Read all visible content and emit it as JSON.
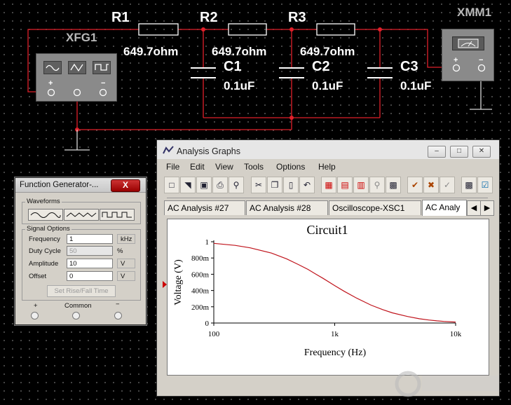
{
  "schematic": {
    "resistors": [
      {
        "name": "R1",
        "value": "649.7ohm"
      },
      {
        "name": "R2",
        "value": "649.7ohm"
      },
      {
        "name": "R3",
        "value": "649.7ohm"
      }
    ],
    "capacitors": [
      {
        "name": "C1",
        "value": "0.1uF"
      },
      {
        "name": "C2",
        "value": "0.1uF"
      },
      {
        "name": "C3",
        "value": "0.1uF"
      }
    ],
    "generator": {
      "name": "XFG1",
      "plus": "+",
      "minus": "−"
    },
    "multimeter": {
      "name": "XMM1",
      "plus": "+",
      "minus": "−"
    },
    "colors": {
      "wire": "#e0202a",
      "ground": "#d8d8d8",
      "component": "#ffffff"
    }
  },
  "function_generator": {
    "title": "Function Generator-...",
    "close_label": "X",
    "waveforms_label": "Waveforms",
    "signal_options_label": "Signal Options",
    "fields": [
      {
        "label": "Frequency",
        "value": "1",
        "unit": "kHz",
        "disabled": false
      },
      {
        "label": "Duty Cycle",
        "value": "50",
        "unit": "%",
        "disabled": true
      },
      {
        "label": "Amplitude",
        "value": "10",
        "unit": "V",
        "disabled": false
      },
      {
        "label": "Offset",
        "value": "0",
        "unit": "V",
        "disabled": false
      }
    ],
    "set_rise_fall_label": "Set Rise/Fall Time",
    "terminals": {
      "plus": "+",
      "common": "Common",
      "minus": "−"
    },
    "waveform_icons": [
      "sine-wave-icon",
      "triangle-wave-icon",
      "square-wave-icon"
    ]
  },
  "analysis_graphs": {
    "title": "Analysis Graphs",
    "window_buttons": {
      "minimize": "–",
      "maximize": "□",
      "close": "✕"
    },
    "menu": [
      "File",
      "Edit",
      "View",
      "Tools",
      "Options",
      "Help"
    ],
    "toolbar_icons": [
      "new-file-icon",
      "open-folder-icon",
      "save-icon",
      "print-icon",
      "print-preview-icon",
      "cut-icon",
      "copy-icon",
      "paste-icon",
      "undo-icon",
      "grid-icon",
      "legend-icon",
      "cursors-icon",
      "zoom-icon",
      "reverse-colors-icon",
      "properties-icon",
      "restore-icon",
      "export-icon",
      "overlay-traces-icon",
      "export-excel-icon"
    ],
    "tabs": [
      "AC Analysis #27",
      "AC Analysis #28",
      "Oscilloscope-XSC1",
      "AC Analy"
    ],
    "active_tab": 3,
    "tab_scroll": {
      "left": "◀",
      "right": "▶"
    }
  },
  "chart_data": {
    "type": "line",
    "title": "Circuit1",
    "xlabel": "Frequency (Hz)",
    "ylabel": "Voltage (V)",
    "x_scale": "log",
    "xlim": [
      100,
      10000
    ],
    "ylim": [
      0,
      1
    ],
    "x_ticks": [
      100,
      1000,
      10000
    ],
    "x_tick_labels": [
      "100",
      "1k",
      "10k"
    ],
    "y_ticks": [
      0,
      0.2,
      0.4,
      0.6,
      0.8,
      1
    ],
    "y_tick_labels": [
      "0",
      "200m",
      "400m",
      "600m",
      "800m",
      "1"
    ],
    "grid": false,
    "line_color": "#c0141c",
    "series": [
      {
        "x": [
          100,
          150,
          200,
          300,
          400,
          500,
          600,
          700,
          800,
          1000,
          1200,
          1500,
          2000,
          2500,
          3000,
          4000,
          5000,
          6000,
          7000,
          8000,
          10000
        ],
        "y": [
          0.98,
          0.955,
          0.925,
          0.86,
          0.79,
          0.72,
          0.66,
          0.6,
          0.55,
          0.46,
          0.39,
          0.31,
          0.22,
          0.165,
          0.125,
          0.08,
          0.053,
          0.037,
          0.027,
          0.02,
          0.012
        ]
      }
    ]
  }
}
